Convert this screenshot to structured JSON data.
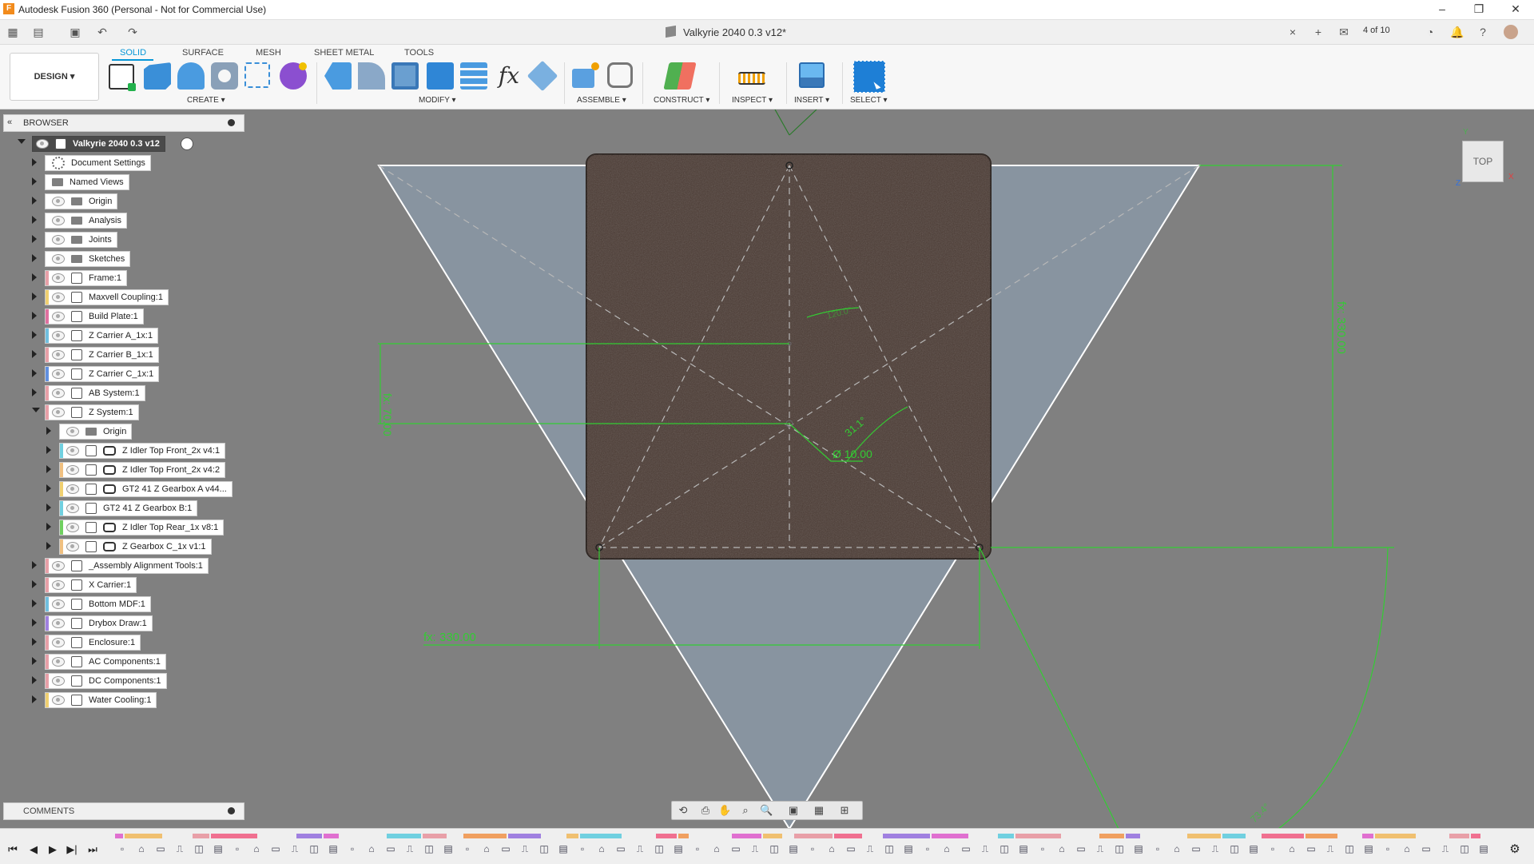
{
  "window": {
    "title": "Autodesk Fusion 360 (Personal - Not for Commercial Use)",
    "controls": [
      "–",
      "❐",
      "✕"
    ]
  },
  "document": {
    "title": "Valkyrie 2040 0.3 v12*",
    "close": "×",
    "version_counter": "4 of 10"
  },
  "toolbar": {
    "workspace": "DESIGN ▾",
    "tabs": [
      "SOLID",
      "SURFACE",
      "MESH",
      "SHEET METAL",
      "TOOLS"
    ],
    "active_tab": "SOLID",
    "groups": [
      "CREATE ▾",
      "MODIFY ▾",
      "ASSEMBLE ▾",
      "CONSTRUCT ▾",
      "INSPECT ▾",
      "INSERT ▾",
      "SELECT ▾"
    ],
    "tool_icons": [
      "create-sketch-icon",
      "extrude-icon",
      "revolve-icon",
      "hole-icon",
      "pattern-icon",
      "form-icon",
      "press-pull-icon",
      "fillet-icon",
      "shell-icon",
      "combine-icon",
      "offset-face-icon",
      "parameters-icon",
      "align-icon",
      "new-component-icon",
      "joint-icon",
      "construct-plane-icon",
      "measure-icon",
      "insert-image-icon",
      "select-icon"
    ],
    "fx_label": "fx"
  },
  "browser": {
    "header": "BROWSER",
    "root": "Valkyrie 2040 0.3 v12",
    "items": [
      {
        "label": "Document Settings",
        "icon": "gear",
        "level": 1,
        "open": false,
        "eye": false,
        "color": ""
      },
      {
        "label": "Named Views",
        "icon": "folder",
        "level": 1,
        "open": false,
        "eye": false,
        "color": ""
      },
      {
        "label": "Origin",
        "icon": "folder",
        "level": 1,
        "open": false,
        "eye": true,
        "color": ""
      },
      {
        "label": "Analysis",
        "icon": "folder",
        "level": 1,
        "open": false,
        "eye": true,
        "color": ""
      },
      {
        "label": "Joints",
        "icon": "folder",
        "level": 1,
        "open": false,
        "eye": true,
        "color": ""
      },
      {
        "label": "Sketches",
        "icon": "folder",
        "level": 1,
        "open": false,
        "eye": true,
        "color": ""
      },
      {
        "label": "Frame:1",
        "icon": "comp",
        "level": 1,
        "open": false,
        "eye": true,
        "color": "#e8a0a8"
      },
      {
        "label": "Maxvell Coupling:1",
        "icon": "comp",
        "level": 1,
        "open": false,
        "eye": true,
        "color": "#f0d070"
      },
      {
        "label": "Build Plate:1",
        "icon": "comp",
        "level": 1,
        "open": false,
        "eye": true,
        "color": "#e070a0"
      },
      {
        "label": "Z Carrier A_1x:1",
        "icon": "comp",
        "level": 1,
        "open": false,
        "eye": true,
        "color": "#70c0e0"
      },
      {
        "label": "Z Carrier B_1x:1",
        "icon": "comp",
        "level": 1,
        "open": false,
        "eye": true,
        "color": "#e8a0a8"
      },
      {
        "label": "Z Carrier C_1x:1",
        "icon": "comp",
        "level": 1,
        "open": false,
        "eye": true,
        "color": "#6090e0"
      },
      {
        "label": "AB System:1",
        "icon": "comp",
        "level": 1,
        "open": false,
        "eye": true,
        "color": "#e8a0a8"
      },
      {
        "label": "Z System:1",
        "icon": "comp",
        "level": 1,
        "open": true,
        "eye": true,
        "color": "#e8a0a8"
      },
      {
        "label": "Origin",
        "icon": "folder",
        "level": 2,
        "open": false,
        "eye": true,
        "color": ""
      },
      {
        "label": "Z Idler Top Front_2x v4:1",
        "icon": "comp-link",
        "level": 2,
        "open": false,
        "eye": true,
        "color": "#70d0e0"
      },
      {
        "label": "Z Idler Top Front_2x v4:2",
        "icon": "comp-link",
        "level": 2,
        "open": false,
        "eye": true,
        "color": "#f0c080"
      },
      {
        "label": "GT2 41 Z Gearbox A v44...",
        "icon": "comp-link",
        "level": 2,
        "open": false,
        "eye": true,
        "color": "#f0d070"
      },
      {
        "label": "GT2 41 Z Gearbox B:1",
        "icon": "comp",
        "level": 2,
        "open": false,
        "eye": true,
        "color": "#70d0e0"
      },
      {
        "label": "Z Idler Top Rear_1x v8:1",
        "icon": "comp-link",
        "level": 2,
        "open": false,
        "eye": true,
        "color": "#70d060"
      },
      {
        "label": "Z Gearbox C_1x v1:1",
        "icon": "comp-link",
        "level": 2,
        "open": false,
        "eye": true,
        "color": "#f0c080"
      },
      {
        "label": "_Assembly Alignment Tools:1",
        "icon": "comp",
        "level": 1,
        "open": false,
        "eye": true,
        "color": "#e8a0a8"
      },
      {
        "label": "X Carrier:1",
        "icon": "comp",
        "level": 1,
        "open": false,
        "eye": true,
        "color": "#e8a0a8"
      },
      {
        "label": "Bottom MDF:1",
        "icon": "comp",
        "level": 1,
        "open": false,
        "eye": true,
        "color": "#70c0e0"
      },
      {
        "label": "Drybox Draw:1",
        "icon": "comp",
        "level": 1,
        "open": false,
        "eye": true,
        "color": "#a080e0"
      },
      {
        "label": "Enclosure:1",
        "icon": "comp",
        "level": 1,
        "open": false,
        "eye": true,
        "color": "#e8a0a8"
      },
      {
        "label": "AC Components:1",
        "icon": "comp",
        "level": 1,
        "open": false,
        "eye": true,
        "color": "#e8a0a8"
      },
      {
        "label": "DC Components:1",
        "icon": "comp",
        "level": 1,
        "open": false,
        "eye": true,
        "color": "#e8a0a8"
      },
      {
        "label": "Water Cooling:1",
        "icon": "comp",
        "level": 1,
        "open": false,
        "eye": true,
        "color": "#f0d070"
      }
    ]
  },
  "comments": {
    "label": "COMMENTS"
  },
  "viewcube": {
    "face": "TOP",
    "axis_y": "Y",
    "axis_x": "X",
    "axis_z": "Z"
  },
  "sketch": {
    "dim_height": "fx: 330.00",
    "dim_width": "fx: 330.00",
    "dim_offset": "fx: 70.00",
    "dim_diameter": "Ø 10.00",
    "dim_angle": "31.1°",
    "dim_angle_small": "120.0°",
    "dim_angle_big": "73.4°",
    "colors": {
      "plate": "#4a3a33",
      "plate_edge": "#2a211d",
      "triangle_fill": "#8a98a6",
      "sketch_line": "#ffffff",
      "dimension": "#33cc33"
    }
  },
  "navbar": {
    "icons": [
      "orbit-icon",
      "look-at-icon",
      "pan-icon",
      "zoom-window-icon",
      "zoom-icon",
      "display-settings-icon",
      "grid-icon",
      "viewports-icon"
    ]
  },
  "timeline": {
    "controls": [
      "⏮",
      "◀",
      "▶",
      "▶|",
      "⏭"
    ],
    "settings": "⚙"
  }
}
